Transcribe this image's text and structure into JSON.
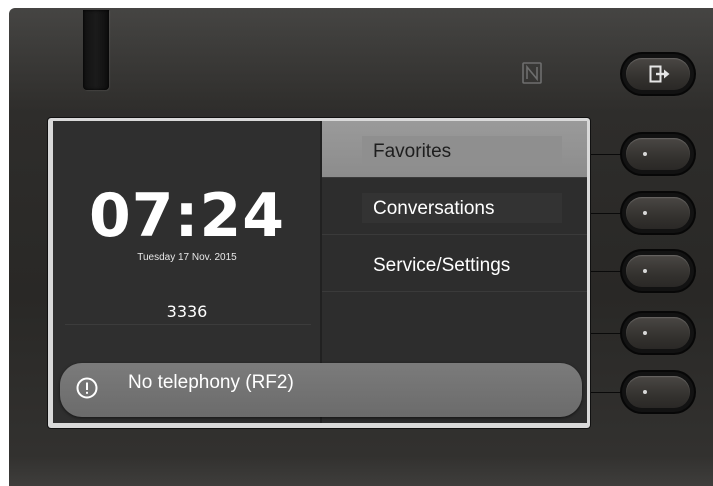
{
  "clock": {
    "time": "07:24",
    "date": "Tuesday 17 Nov. 2015"
  },
  "extension": "3336",
  "menu": {
    "items": [
      {
        "label": "Favorites",
        "selected": true
      },
      {
        "label": "Conversations",
        "selected": false
      },
      {
        "label": "Service/Settings",
        "selected": false
      }
    ]
  },
  "notification": {
    "text": "No telephony (RF2)",
    "icon": "alert-circle-icon"
  },
  "hardware": {
    "top_key_icon": "exit-icon",
    "nfc_icon": "nfc-icon",
    "softkey_icon": "dot-icon"
  },
  "colors": {
    "housing": "#2e2d2b",
    "screen_background": "#2c2c2c",
    "selected_item": "#949494",
    "notification": "#737373"
  }
}
